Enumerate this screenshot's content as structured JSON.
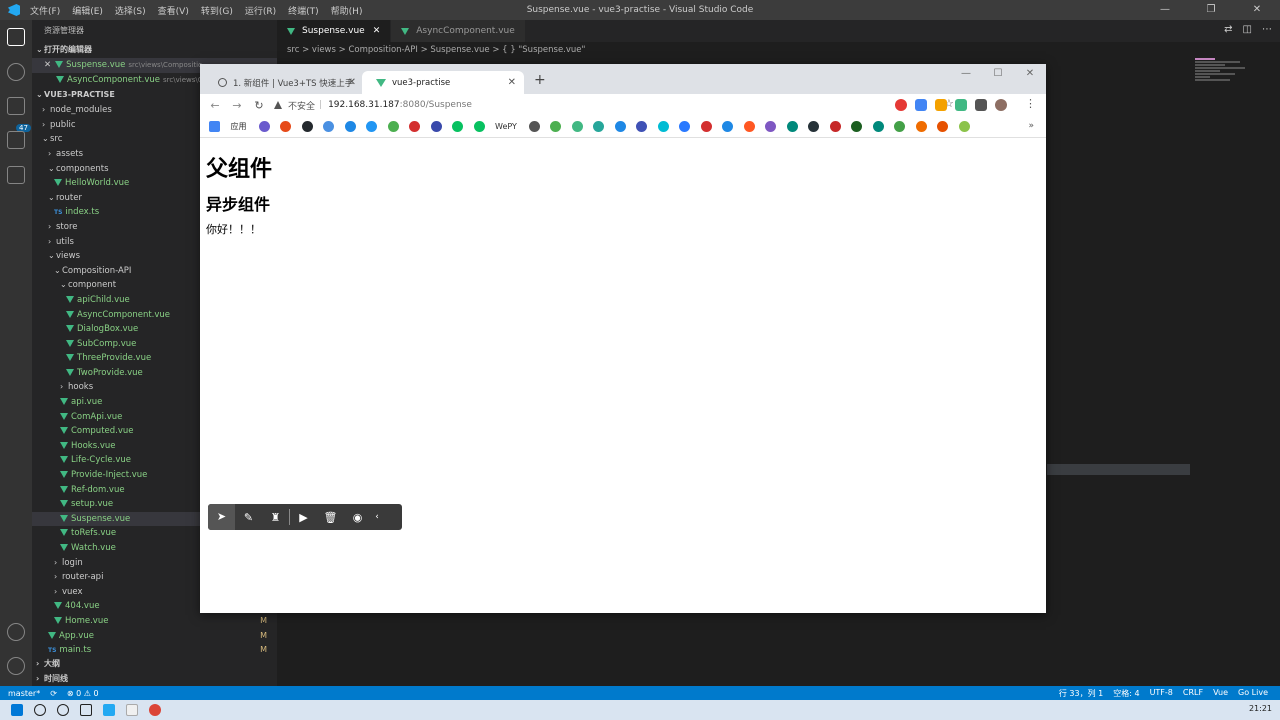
{
  "vscode": {
    "window_title": "Suspense.vue - vue3-practise - Visual Studio Code",
    "menu": [
      "文件(F)",
      "编辑(E)",
      "选择(S)",
      "查看(V)",
      "转到(G)",
      "运行(R)",
      "终端(T)",
      "帮助(H)"
    ],
    "window_controls": [
      "—",
      "❐",
      "✕"
    ],
    "scm_badge": "47",
    "sidebar": {
      "title": "资源管理器",
      "open_editors_label": "打开的编辑器",
      "open_editors": [
        {
          "name": "Suspense.vue",
          "path": "src\\views\\Compositio..."
        },
        {
          "name": "AsyncComponent.vue",
          "path": "src\\views\\Co..."
        }
      ],
      "project_label": "VUE3-PRACTISE",
      "tree": [
        {
          "label": "node_modules",
          "kind": "folder",
          "indent": 1,
          "open": false
        },
        {
          "label": "public",
          "kind": "folder",
          "indent": 1,
          "open": false
        },
        {
          "label": "src",
          "kind": "folder",
          "indent": 1,
          "open": true
        },
        {
          "label": "assets",
          "kind": "folder",
          "indent": 2,
          "open": false
        },
        {
          "label": "components",
          "kind": "folder",
          "indent": 2,
          "open": true
        },
        {
          "label": "HelloWorld.vue",
          "kind": "vue",
          "indent": 3
        },
        {
          "label": "router",
          "kind": "folder",
          "indent": 2,
          "open": true
        },
        {
          "label": "index.ts",
          "kind": "ts",
          "indent": 3
        },
        {
          "label": "store",
          "kind": "folder",
          "indent": 2,
          "open": false
        },
        {
          "label": "utils",
          "kind": "folder",
          "indent": 2,
          "open": false
        },
        {
          "label": "views",
          "kind": "folder",
          "indent": 2,
          "open": true
        },
        {
          "label": "Composition-API",
          "kind": "folder",
          "indent": 3,
          "open": true
        },
        {
          "label": "component",
          "kind": "folder",
          "indent": 4,
          "open": true
        },
        {
          "label": "apiChild.vue",
          "kind": "vue",
          "indent": 5
        },
        {
          "label": "AsyncComponent.vue",
          "kind": "vue",
          "indent": 5
        },
        {
          "label": "DialogBox.vue",
          "kind": "vue",
          "indent": 5
        },
        {
          "label": "SubComp.vue",
          "kind": "vue",
          "indent": 5
        },
        {
          "label": "ThreeProvide.vue",
          "kind": "vue",
          "indent": 5
        },
        {
          "label": "TwoProvide.vue",
          "kind": "vue",
          "indent": 5
        },
        {
          "label": "hooks",
          "kind": "folder",
          "indent": 4,
          "open": false
        },
        {
          "label": "api.vue",
          "kind": "vue",
          "indent": 4
        },
        {
          "label": "ComApi.vue",
          "kind": "vue",
          "indent": 4
        },
        {
          "label": "Computed.vue",
          "kind": "vue",
          "indent": 4
        },
        {
          "label": "Hooks.vue",
          "kind": "vue",
          "indent": 4
        },
        {
          "label": "Life-Cycle.vue",
          "kind": "vue",
          "indent": 4
        },
        {
          "label": "Provide-Inject.vue",
          "kind": "vue",
          "indent": 4
        },
        {
          "label": "Ref-dom.vue",
          "kind": "vue",
          "indent": 4
        },
        {
          "label": "setup.vue",
          "kind": "vue",
          "indent": 4
        },
        {
          "label": "Suspense.vue",
          "kind": "vue",
          "indent": 4,
          "selected": true
        },
        {
          "label": "toRefs.vue",
          "kind": "vue",
          "indent": 4
        },
        {
          "label": "Watch.vue",
          "kind": "vue",
          "indent": 4
        },
        {
          "label": "login",
          "kind": "folder",
          "indent": 3,
          "open": false
        },
        {
          "label": "router-api",
          "kind": "folder",
          "indent": 3,
          "open": false
        },
        {
          "label": "vuex",
          "kind": "folder",
          "indent": 3,
          "open": false
        },
        {
          "label": "404.vue",
          "kind": "vue",
          "indent": 3
        },
        {
          "label": "Home.vue",
          "kind": "vue",
          "indent": 3,
          "flag": "M"
        },
        {
          "label": "App.vue",
          "kind": "vue",
          "indent": 2,
          "flag": "M"
        },
        {
          "label": "main.ts",
          "kind": "ts",
          "indent": 2,
          "flag": "M"
        }
      ],
      "outline_label": "大纲",
      "timeline_label": "时间线"
    },
    "tabs": [
      {
        "label": "Suspense.vue",
        "active": true,
        "close": "✕"
      },
      {
        "label": "AsyncComponent.vue",
        "active": false,
        "close": ""
      }
    ],
    "breadcrumb": "src > views > Composition-API > Suspense.vue > { } \"Suspense.vue\"",
    "statusbar": {
      "left": [
        "master*",
        "⟳",
        "⊗ 0 ⚠ 0"
      ],
      "right": [
        "行 33，列 1",
        "空格: 4",
        "UTF-8",
        "CRLF",
        "Vue",
        "Go Live"
      ]
    }
  },
  "chrome": {
    "tabs": [
      {
        "label": "1. 新组件 | Vue3+TS 快速上手",
        "active": false
      },
      {
        "label": "vue3-practise",
        "active": true
      }
    ],
    "new_tab": "+",
    "insecure_label": "不安全",
    "url_host": "192.168.31.187",
    "url_path": ":8080/Suspense",
    "bookmarks_apps_label": "应用",
    "bookmark_wepy_label": "WePY",
    "bookmarks_more": "»",
    "page": {
      "h1": "父组件",
      "h2": "异步组件",
      "text": "你好！！！"
    }
  },
  "taskbar": {
    "clock": "21:21"
  }
}
